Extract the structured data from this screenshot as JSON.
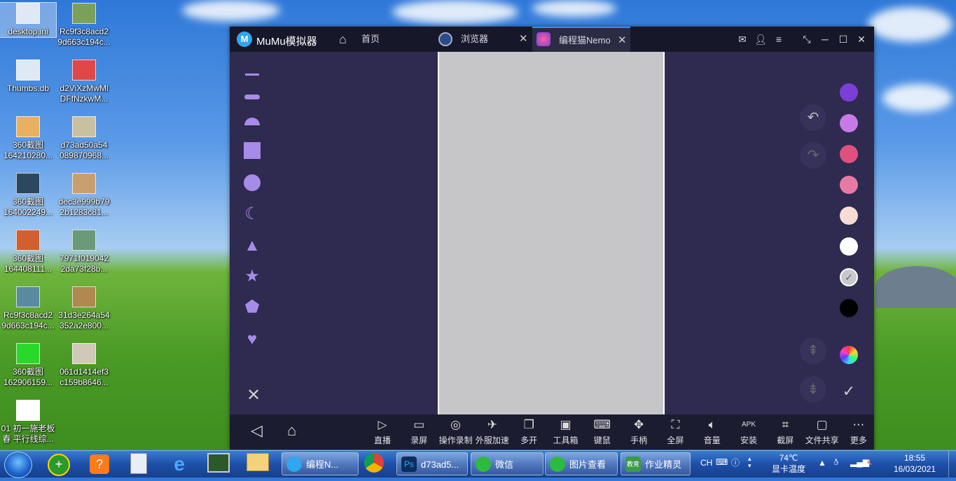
{
  "desktop": {
    "icons": [
      {
        "label1": "desktop.ini",
        "label2": ""
      },
      {
        "label1": "Rc9f3c8acd2",
        "label2": "9d663c194c..."
      },
      {
        "label1": "Thumbs.db",
        "label2": ""
      },
      {
        "label1": "d2ViXzMwMl",
        "label2": "DFfNzkwM..."
      },
      {
        "label1": "360截图",
        "label2": "164210280..."
      },
      {
        "label1": "d73ad50a54",
        "label2": "089870968..."
      },
      {
        "label1": "360截图",
        "label2": "164002249..."
      },
      {
        "label1": "dec3e999b79",
        "label2": "2b1283c81..."
      },
      {
        "label1": "360截图",
        "label2": "164408111..."
      },
      {
        "label1": "7971f019042",
        "label2": "2da73f28b..."
      },
      {
        "label1": "Rc9f3c8acd2",
        "label2": "9d663c194c..."
      },
      {
        "label1": "31d3e264a54",
        "label2": "352a2e800..."
      },
      {
        "label1": "360截图",
        "label2": "162906159..."
      },
      {
        "label1": "061d1414ef3",
        "label2": "c159b8646..."
      },
      {
        "label1": "01 初一施老板",
        "label2": "春 平行线综..."
      }
    ]
  },
  "window": {
    "app_title": "MuMu模拟器",
    "tabs": [
      {
        "label": "首页",
        "icon": "home-icon"
      },
      {
        "label": "浏览器",
        "icon": "compass-icon"
      },
      {
        "label": "编程猫Nemo",
        "icon": "nemo-app-icon"
      }
    ],
    "titlebar_icons": [
      "mail-icon",
      "user-icon",
      "menu-icon",
      "resize-icon",
      "minimize-icon",
      "maximize-icon",
      "close-icon"
    ]
  },
  "editor": {
    "shapes": [
      "line-thin-shape",
      "line-thick-shape",
      "semicircle-shape",
      "square-shape",
      "circle-shape",
      "crescent-shape",
      "triangle-shape",
      "star-shape",
      "pentagon-shape",
      "heart-shape"
    ],
    "colors": [
      "#7b3fd6",
      "#c77ae6",
      "#e0507e",
      "#e77aa5",
      "#f7dcd6",
      "#ffffff",
      "#c8c8cc",
      "#000000"
    ],
    "selected_color_index": 6,
    "accent": "#a78be8"
  },
  "toolbar": {
    "tools": [
      {
        "label": "直播",
        "icon": "tv-icon"
      },
      {
        "label": "录屏",
        "icon": "video-icon"
      },
      {
        "label": "操作录制",
        "icon": "record-icon"
      },
      {
        "label": "外服加速",
        "icon": "rocket-icon"
      },
      {
        "label": "多开",
        "icon": "multi-icon"
      },
      {
        "label": "工具箱",
        "icon": "toolbox-icon"
      },
      {
        "label": "键鼠",
        "icon": "keyboard-icon"
      },
      {
        "label": "手柄",
        "icon": "gamepad-icon"
      },
      {
        "label": "全屏",
        "icon": "fullscreen-icon"
      },
      {
        "label": "音量",
        "icon": "mute-icon"
      },
      {
        "label": "安装",
        "icon": "apk-icon"
      },
      {
        "label": "截屏",
        "icon": "crop-icon"
      },
      {
        "label": "文件共享",
        "icon": "folder-icon"
      },
      {
        "label": "更多",
        "icon": "more-icon"
      }
    ],
    "apk_text": "APK"
  },
  "taskbar": {
    "tasks": [
      {
        "label": "编程N...",
        "color": "#2fa6ee"
      },
      {
        "label": "d73ad5...",
        "color": "#0d2d5a"
      },
      {
        "label": "微信",
        "color": "#2dbb3f"
      },
      {
        "label": "图片查看",
        "color": "#2dbb3f"
      },
      {
        "label": "作业精灵",
        "color": "#3a9a4a"
      }
    ],
    "chrome_label": "",
    "lang": "CH",
    "temp": "74℃",
    "temp_label": "显卡温度",
    "time": "18:55",
    "date": "16/03/2021",
    "edu_badge": "教育"
  }
}
